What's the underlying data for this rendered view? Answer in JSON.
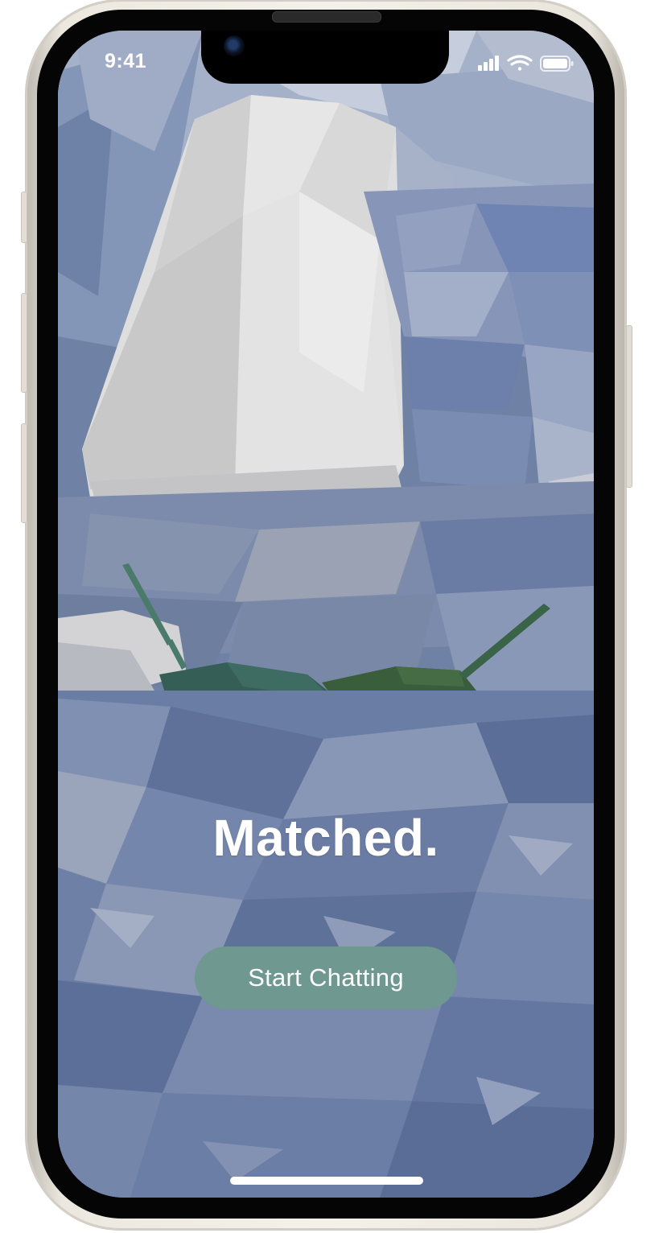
{
  "status_bar": {
    "time": "9:41",
    "icons": [
      "cellular-signal-icon",
      "wifi-icon",
      "battery-icon"
    ]
  },
  "main": {
    "title": "Matched.",
    "start_button_label": "Start Chatting"
  },
  "colors": {
    "button_background": "#6f9890",
    "title_text": "#ffffff",
    "water_base": "#6f82a6",
    "iceberg": "#dcdcdc",
    "boat_left": "#2f5a50",
    "boat_right": "#345838"
  }
}
